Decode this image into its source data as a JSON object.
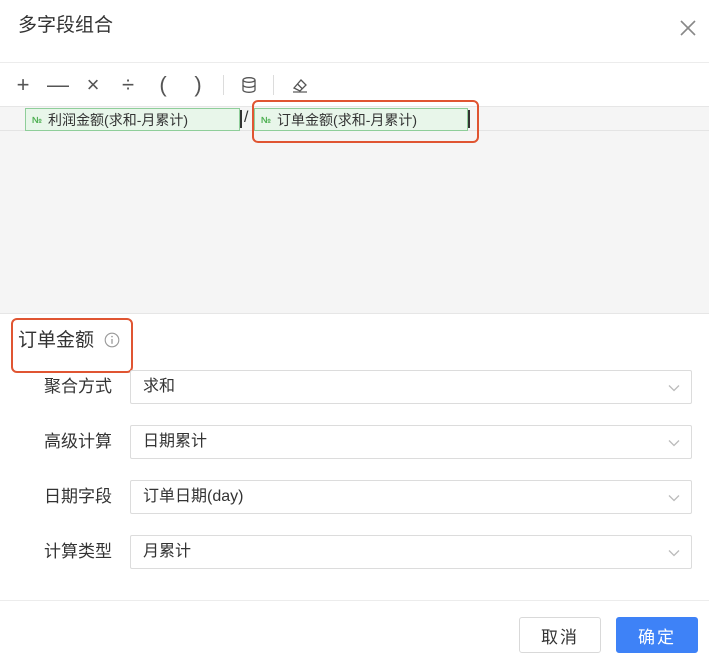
{
  "dialog": {
    "title": "多字段组合"
  },
  "toolbar": {
    "items": [
      {
        "label": "+",
        "name": "add-operator-button"
      },
      {
        "label": "—",
        "name": "subtract-operator-button"
      },
      {
        "label": "×",
        "name": "multiply-operator-button"
      },
      {
        "label": "÷",
        "name": "divide-operator-button"
      },
      {
        "label": "(",
        "name": "open-paren-button"
      },
      {
        "label": ")",
        "name": "close-paren-button"
      }
    ]
  },
  "formula": {
    "field1": {
      "badge": "№",
      "label": "利润金额(求和-月累计)"
    },
    "operator": "/",
    "field2": {
      "badge": "№",
      "label": "订单金额(求和-月累计)"
    }
  },
  "detail": {
    "title": "订单金额",
    "rows": [
      {
        "label": "聚合方式",
        "value": "求和"
      },
      {
        "label": "高级计算",
        "value": "日期累计"
      },
      {
        "label": "日期字段",
        "value": "订单日期(day)"
      },
      {
        "label": "计算类型",
        "value": "月累计"
      }
    ]
  },
  "footer": {
    "cancel_label": "取消",
    "ok_label": "确定"
  },
  "colors": {
    "accent": "#3e82f7",
    "highlight": "#e05532",
    "field_tag_bg": "#e8f6ea",
    "field_tag_border": "#8fce9a"
  }
}
